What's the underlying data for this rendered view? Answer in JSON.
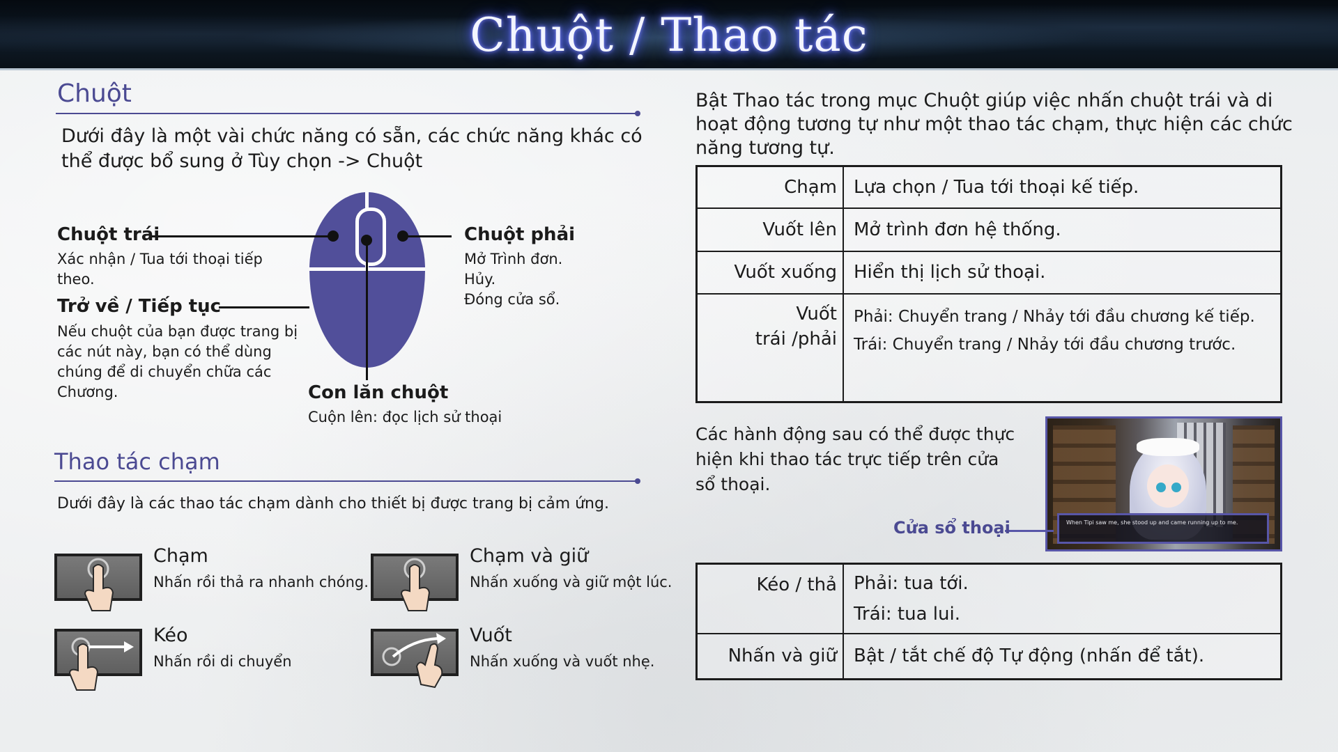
{
  "header": {
    "title": "Chuột / Thao tác"
  },
  "mouse_section": {
    "title": "Chuột",
    "intro": "Dưới đây là một vài chức năng có sẵn, các chức năng khác có thể được bổ sung ở Tùy chọn -> Chuột",
    "left_click": {
      "label": "Chuột trái",
      "desc": "Xác nhận / Tua tới thoại tiếp theo."
    },
    "back_forward": {
      "label": "Trở về / Tiếp tục",
      "desc": "Nếu chuột của bạn được trang bị các nút này, bạn có thể dùng chúng để di chuyển chữa các Chương."
    },
    "right_click": {
      "label": "Chuột phải",
      "desc_lines": [
        "Mở Trình đơn.",
        "Hủy.",
        "Đóng cửa sổ."
      ]
    },
    "wheel": {
      "label": "Con lăn chuột",
      "desc": "Cuộn lên: đọc lịch sử thoại"
    }
  },
  "touch_section": {
    "title": "Thao tác chạm",
    "intro": "Dưới đây là các thao tác chạm dành cho thiết bị được trang bị cảm ứng.",
    "gestures": [
      {
        "name": "Chạm",
        "desc": "Nhấn rồi thả ra nhanh chóng.",
        "icon": "tap-icon"
      },
      {
        "name": "Chạm và giữ",
        "desc": "Nhấn xuống và giữ một lúc.",
        "icon": "tap-hold-icon"
      },
      {
        "name": "Kéo",
        "desc": "Nhấn rồi di chuyển",
        "icon": "drag-icon"
      },
      {
        "name": "Vuốt",
        "desc": "Nhấn xuống và vuốt nhẹ.",
        "icon": "swipe-icon"
      }
    ]
  },
  "right_panel": {
    "intro": "Bật Thao tác trong mục Chuột giúp việc nhấn chuột trái và di hoạt động tương tự như một thao tác chạm, thực hiện các chức năng tương tự.",
    "table1": [
      {
        "key": "Chạm",
        "value": "Lựa chọn / Tua tới thoại kế tiếp."
      },
      {
        "key": "Vuốt lên",
        "value": "Mở trình đơn hệ thống."
      },
      {
        "key": "Vuốt xuống",
        "value": "Hiển thị lịch sử thoại."
      },
      {
        "key_line1": "Vuốt",
        "key_line2": "trái /phải",
        "value_line1": "Phải: Chuyển trang / Nhảy tới đầu chương kế tiếp.",
        "value_line2": "Trái: Chuyển trang / Nhảy tới đầu chương trước."
      }
    ],
    "dialog_note": "Các hành động sau có thể  được thực hiện khi thao tác trực tiếp trên cửa sổ thoại.",
    "dialog_label": "Cửa sổ thoại",
    "dialog_text": "When Tipi saw me, she stood up and came running up to me.",
    "table2": [
      {
        "key": "Kéo / thả",
        "value_line1": "Phải: tua tới.",
        "value_line2": "Trái: tua lui."
      },
      {
        "key": "Nhấn và giữ",
        "value": "Bật / tắt chế độ Tự động (nhấn để tắt)."
      }
    ]
  },
  "colors": {
    "accent": "#4b4a92",
    "mouse": "#514f9a",
    "header_glow": "#4c57e8"
  }
}
